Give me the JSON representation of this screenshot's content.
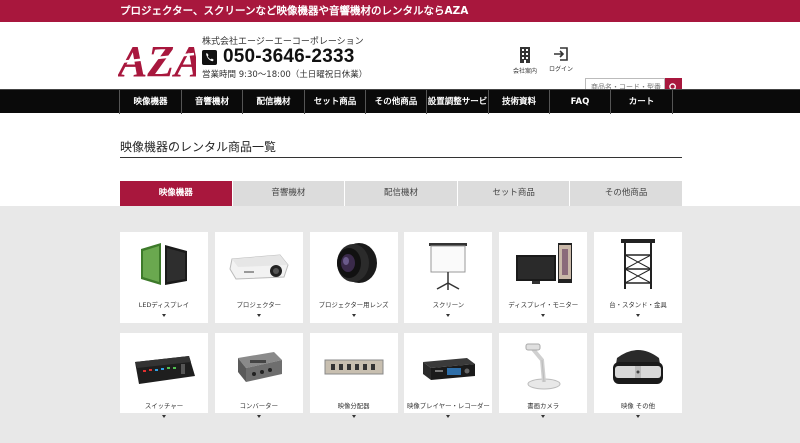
{
  "topbar": {
    "text": "プロジェクター、スクリーンなど映像機器や音響機材のレンタルならAZA"
  },
  "header": {
    "logo_text": "AZA",
    "company_name": "株式会社エージーエーコーポレーション",
    "phone": "050-3646-2333",
    "hours": "営業時間 9:30〜18:00（土日曜祝日休業）",
    "company_link": "会社案内",
    "login_link": "ログイン",
    "search_placeholder": "商品名・コード・型番"
  },
  "nav": {
    "items": [
      "映像機器",
      "音響機材",
      "配信機材",
      "セット商品",
      "その他商品",
      "設置調整サービス",
      "技術資料",
      "FAQ",
      "カート"
    ]
  },
  "section": {
    "title": "映像機器のレンタル商品一覧"
  },
  "tabs": [
    "映像機器",
    "音響機材",
    "配信機材",
    "セット商品",
    "その他商品"
  ],
  "active_tab": "映像機器",
  "categories": [
    {
      "label": "LEDディスプレイ",
      "icon": "led-display-icon"
    },
    {
      "label": "プロジェクター",
      "icon": "projector-icon"
    },
    {
      "label": "プロジェクター用レンズ",
      "icon": "projector-lens-icon"
    },
    {
      "label": "スクリーン",
      "icon": "screen-icon"
    },
    {
      "label": "ディスプレイ・モニター",
      "icon": "monitor-icon"
    },
    {
      "label": "台・スタンド・金具",
      "icon": "stand-icon"
    },
    {
      "label": "スイッチャー",
      "icon": "switcher-icon"
    },
    {
      "label": "コンバーター",
      "icon": "converter-icon"
    },
    {
      "label": "映像分配器",
      "icon": "distributor-icon"
    },
    {
      "label": "映像プレイヤー・レコーダー",
      "icon": "player-recorder-icon"
    },
    {
      "label": "書画カメラ",
      "icon": "document-camera-icon"
    },
    {
      "label": "映像 その他",
      "icon": "vr-headset-icon"
    }
  ],
  "colors": {
    "accent": "#a8173d",
    "nav_bg": "#0a0a0a",
    "tab_bg": "#dcdcdc",
    "grid_bg": "#e8e8e8"
  }
}
